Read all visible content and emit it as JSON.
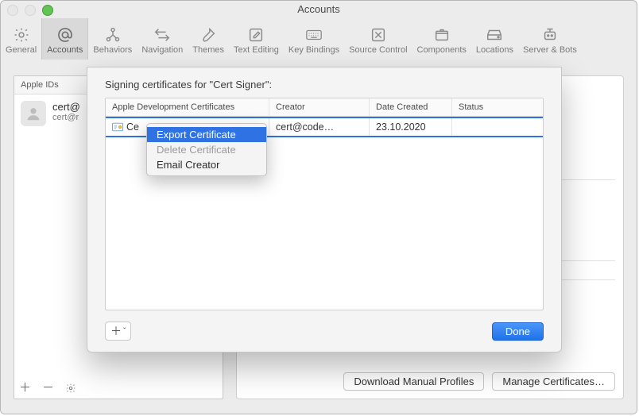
{
  "window": {
    "title": "Accounts"
  },
  "toolbar": {
    "items": [
      {
        "label": "General",
        "icon": "gear-icon"
      },
      {
        "label": "Accounts",
        "icon": "at-icon",
        "selected": true
      },
      {
        "label": "Behaviors",
        "icon": "nodes-icon"
      },
      {
        "label": "Navigation",
        "icon": "swap-icon"
      },
      {
        "label": "Themes",
        "icon": "brush-icon"
      },
      {
        "label": "Text Editing",
        "icon": "compose-icon"
      },
      {
        "label": "Key Bindings",
        "icon": "keyboard-icon"
      },
      {
        "label": "Source Control",
        "icon": "branch-icon"
      },
      {
        "label": "Components",
        "icon": "box-icon"
      },
      {
        "label": "Locations",
        "icon": "drive-icon"
      },
      {
        "label": "Server & Bots",
        "icon": "robot-icon"
      }
    ]
  },
  "sidebar": {
    "header": "Apple IDs",
    "account": {
      "line1": "cert@",
      "line2": "cert@r"
    }
  },
  "right_panel": {
    "download_btn": "Download Manual Profiles",
    "manage_btn": "Manage Certificates…"
  },
  "sheet": {
    "title": "Signing certificates for \"Cert Signer\":",
    "columns": {
      "name": "Apple Development Certificates",
      "creator": "Creator",
      "date": "Date Created",
      "status": "Status"
    },
    "rows": [
      {
        "name": "Ce",
        "creator": "cert@code…",
        "date": "23.10.2020",
        "status": ""
      }
    ],
    "done": "Done"
  },
  "context_menu": {
    "items": [
      {
        "label": "Export Certificate",
        "state": "selected"
      },
      {
        "label": "Delete Certificate",
        "state": "disabled"
      },
      {
        "label": "Email Creator",
        "state": "normal"
      }
    ]
  }
}
